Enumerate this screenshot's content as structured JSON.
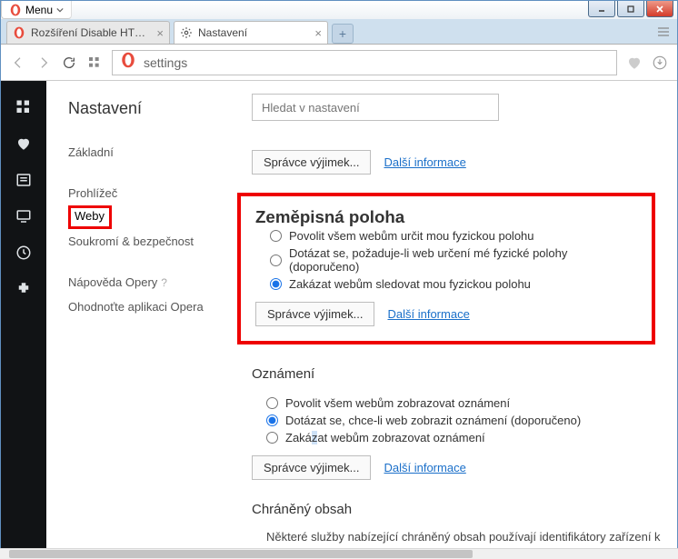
{
  "window": {
    "menu_label": "Menu"
  },
  "tabs": {
    "tab1_label": "Rozšíření Disable HTML5 A",
    "tab2_label": "Nastavení"
  },
  "address_bar": {
    "value": "settings"
  },
  "settings": {
    "title": "Nastavení",
    "nav": {
      "basic": "Základní",
      "browser": "Prohlížeč",
      "websites": "Weby",
      "privacy": "Soukromí & bezpečnost",
      "help": "Nápověda Opery",
      "rate": "Ohodnoťte aplikaci Opera"
    },
    "search_placeholder": "Hledat v nastavení",
    "top_row": {
      "exceptions": "Správce výjimek...",
      "more": "Další informace"
    },
    "geo": {
      "title": "Zeměpisná poloha",
      "opt1": "Povolit všem webům určit mou fyzickou polohu",
      "opt2": "Dotázat se, požaduje-li web určení mé fyzické polohy (doporučeno)",
      "opt3": "Zakázat webům sledovat mou fyzickou polohu",
      "exceptions": "Správce výjimek...",
      "more": "Další informace"
    },
    "notif": {
      "title": "Oznámení",
      "opt1": "Povolit všem webům zobrazovat oznámení",
      "opt2": "Dotázat se, chce-li web zobrazit oznámení (doporučeno)",
      "opt3_a": "Zaká",
      "opt3_b": "z",
      "opt3_c": "at webům zobrazovat oznámení",
      "exceptions": "Správce výjimek...",
      "more": "Další informace"
    },
    "protected": {
      "title": "Chráněný obsah",
      "desc": "Některé služby nabízející chráněný obsah používají identifikátory zařízení k"
    }
  }
}
